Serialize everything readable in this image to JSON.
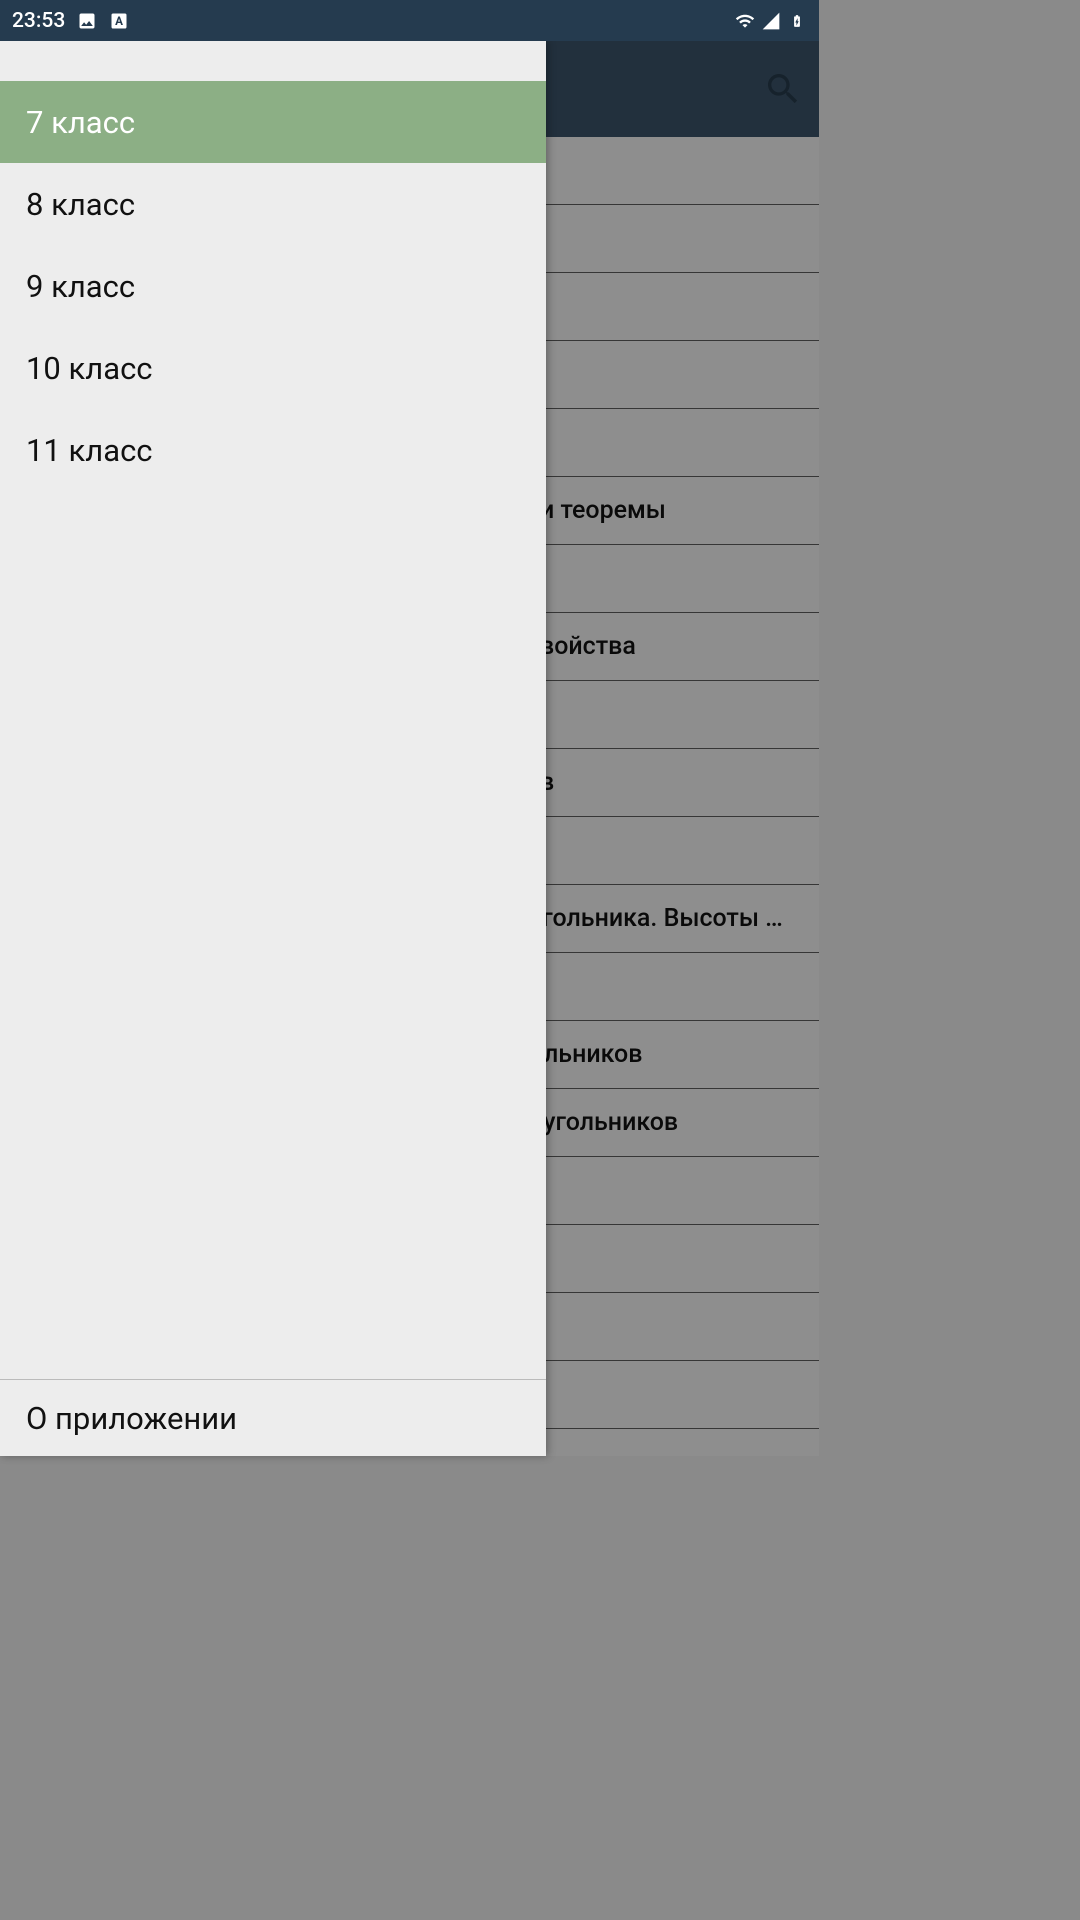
{
  "status_bar": {
    "time": "23:53"
  },
  "drawer": {
    "items": [
      {
        "label": "7 класс",
        "selected": true
      },
      {
        "label": "8 класс",
        "selected": false
      },
      {
        "label": "9 класс",
        "selected": false
      },
      {
        "label": "10 класс",
        "selected": false
      },
      {
        "label": "11 класс",
        "selected": false
      }
    ],
    "footer": "О приложении"
  },
  "content": {
    "items": [
      {
        "text": ""
      },
      {
        "text": ""
      },
      {
        "text": ""
      },
      {
        "text": ""
      },
      {
        "text": ""
      },
      {
        "text": "и теоремы"
      },
      {
        "text": ""
      },
      {
        "text": "войства"
      },
      {
        "text": ""
      },
      {
        "text": "в"
      },
      {
        "text": ""
      },
      {
        "text": "угольника. Высоты …"
      },
      {
        "text": ""
      },
      {
        "text": "ольников"
      },
      {
        "text": "еугольников"
      },
      {
        "text": ""
      },
      {
        "text": ""
      },
      {
        "text": ""
      },
      {
        "text": ""
      },
      {
        "text": ""
      }
    ]
  }
}
